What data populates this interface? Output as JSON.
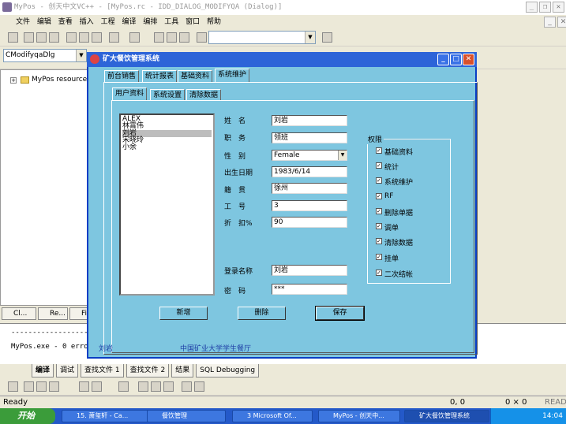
{
  "ide": {
    "title": "MyPos - 创天中文VC++ - [MyPos.rc - IDD_DIALOG_MODIFYQA (Dialog)]",
    "menu": [
      "文件",
      "编辑",
      "查看",
      "插入",
      "工程",
      "编译",
      "编排",
      "工具",
      "窗口",
      "帮助"
    ],
    "class_combo": "CModifyqaDlg",
    "tree_root": "MyPos resource",
    "workspace_tabs": [
      "Cl...",
      "Re...",
      "Fi"
    ],
    "output_separator": "-------------------------",
    "output_line": "MyPos.exe - 0 erro",
    "output_tabs": [
      "编译",
      "调试",
      "查找文件 1",
      "查找文件 2",
      "结果",
      "SQL Debugging"
    ],
    "status_ready": "Ready",
    "status_pos": "0, 0",
    "status_size": "0 × 0",
    "status_read": "READ"
  },
  "dialog": {
    "title": "矿大餐饮管理系统",
    "main_tabs": [
      "前台销售",
      "统计报表",
      "基础资料",
      "系统维护"
    ],
    "sub_tabs": [
      "用户资料",
      "系统设置",
      "清除数据"
    ],
    "users": [
      "ALEX",
      "林霄伟",
      "刘岩",
      "宋晓玲",
      "小余"
    ],
    "labels": {
      "name": "姓　名",
      "position": "职　务",
      "gender": "性　别",
      "birth": "出生日期",
      "origin": "籍　贯",
      "job_no": "工　号",
      "discount": "折　扣%",
      "login": "登录名称",
      "password": "密　码"
    },
    "values": {
      "name": "刘岩",
      "position": "领班",
      "gender": "Female",
      "birth": "1983/6/14",
      "origin": "徐州",
      "job_no": "3",
      "discount": "90",
      "login": "刘岩",
      "password": "***"
    },
    "permissions_title": "权限",
    "permissions": [
      "基础资料",
      "统计",
      "系统维护",
      "RF",
      "删除单据",
      "调单",
      "清除数据",
      "挂单",
      "二次结帐"
    ],
    "buttons": {
      "add": "新增",
      "delete": "删除",
      "save": "保存"
    },
    "footer_user": "刘岩",
    "footer_org": "中国矿业大学学生餐厅"
  },
  "taskbar": {
    "start": "开始",
    "tasks": [
      "15. 萧玺轩 - Ca...",
      "餐饮管理",
      "3 Microsoft Of...",
      "MyPos - 创天中...",
      "矿大餐饮管理系统"
    ],
    "clock": "14:04"
  }
}
